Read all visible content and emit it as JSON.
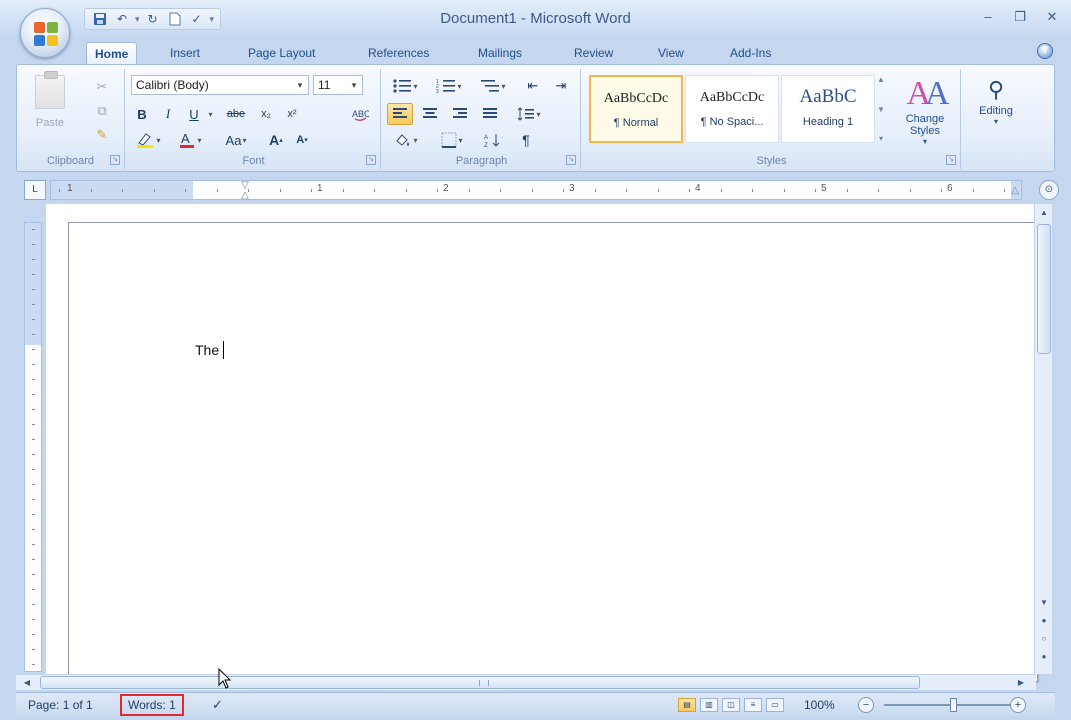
{
  "window": {
    "title": "Document1 - Microsoft Word"
  },
  "quick_access": {
    "more": "▾"
  },
  "tabs": [
    {
      "label": "Home",
      "active": true
    },
    {
      "label": "Insert"
    },
    {
      "label": "Page Layout"
    },
    {
      "label": "References"
    },
    {
      "label": "Mailings"
    },
    {
      "label": "Review"
    },
    {
      "label": "View"
    },
    {
      "label": "Add-Ins"
    }
  ],
  "ribbon": {
    "clipboard": {
      "label": "Clipboard",
      "paste_label": "Paste"
    },
    "font": {
      "label": "Font",
      "font_name": "Calibri (Body)",
      "font_size": "11",
      "bold": "B",
      "italic": "I",
      "underline": "U",
      "strike": "abe",
      "subscript": "x₂",
      "superscript": "x²",
      "change_case": "Aa",
      "grow": "A",
      "shrink": "A"
    },
    "paragraph": {
      "label": "Paragraph",
      "pilcrow": "¶"
    },
    "styles": {
      "label": "Styles",
      "items": [
        {
          "sample": "AaBbCcDc",
          "name": "¶ Normal",
          "selected": true
        },
        {
          "sample": "AaBbCcDc",
          "name": "¶ No Spaci..."
        },
        {
          "sample": "AaBbC",
          "name": "Heading 1"
        }
      ],
      "change_styles_label": "Change Styles"
    },
    "editing": {
      "label": "Editing"
    }
  },
  "ruler": {
    "numbers": [
      "1",
      "1",
      "2",
      "3",
      "4",
      "5",
      "6"
    ]
  },
  "document": {
    "text": "The"
  },
  "status": {
    "page": "Page: 1 of 1",
    "words": "Words: 1",
    "zoom": "100%"
  },
  "colors": {
    "accent": "#15428b",
    "highlight_box": "#e5272e",
    "selected_style": "#f2b84c"
  }
}
